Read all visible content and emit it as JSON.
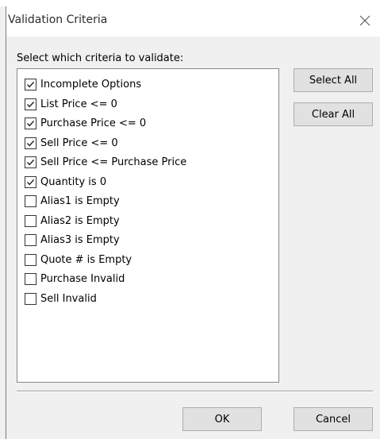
{
  "dialog": {
    "title": "Validation Criteria",
    "prompt": "Select which criteria to validate:"
  },
  "criteria": [
    {
      "label": "Incomplete Options",
      "checked": true
    },
    {
      "label": "List Price <= 0",
      "checked": true
    },
    {
      "label": "Purchase Price <= 0",
      "checked": true
    },
    {
      "label": "Sell Price <= 0",
      "checked": true
    },
    {
      "label": "Sell Price <= Purchase Price",
      "checked": true
    },
    {
      "label": "Quantity is 0",
      "checked": true
    },
    {
      "label": "Alias1 is Empty",
      "checked": false
    },
    {
      "label": "Alias2 is Empty",
      "checked": false
    },
    {
      "label": "Alias3 is Empty",
      "checked": false
    },
    {
      "label": "Quote # is Empty",
      "checked": false
    },
    {
      "label": "Purchase Invalid",
      "checked": false
    },
    {
      "label": "Sell Invalid",
      "checked": false
    }
  ],
  "buttons": {
    "select_all": "Select All",
    "clear_all": "Clear All",
    "ok": "OK",
    "cancel": "Cancel"
  },
  "icons": {
    "close": "close-icon",
    "check": "checkmark-icon"
  }
}
